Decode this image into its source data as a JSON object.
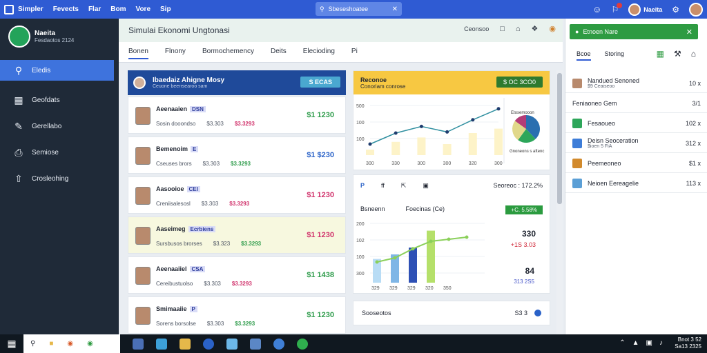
{
  "menubar": {
    "items": [
      "Simpler",
      "Fevects",
      "Flar",
      "Bom",
      "Vore",
      "Sip"
    ],
    "search_text": "Sbeseshoatee"
  },
  "sidebar": {
    "profile_name": "Naeita",
    "profile_sub": "Fesdaotos 2124",
    "items": [
      {
        "label": "Eledis",
        "icon": "search-icon",
        "active": true
      },
      {
        "label": "Geofdats",
        "icon": "grid-icon"
      },
      {
        "label": "Gerellabo",
        "icon": "pen-icon"
      },
      {
        "label": "Semiose",
        "icon": "printer-icon"
      },
      {
        "label": "Crosleohing",
        "icon": "upload-icon"
      }
    ]
  },
  "header": {
    "title": "Simulai Ekonomi Ungtonasi",
    "right_label": "Ceonsoo",
    "tabs": [
      "Bonen",
      "Flnony",
      "Bormochemency",
      "Deits",
      "Elecioding",
      "Pi"
    ]
  },
  "list": {
    "header_title": "Ibaedaiz Ahigne Mosy",
    "header_sub": "Ceuone beerrsearoo sam",
    "header_button": "S ECAS",
    "cards": [
      {
        "name": "Aeenaaien",
        "tag": "DSN",
        "m1": "Sosin dooondso",
        "m2": "$3.303",
        "m3": "$3.3293",
        "amount": "$1 1230",
        "amount_color": "#2d9b4a",
        "highlight": false
      },
      {
        "name": "Bemenoim",
        "tag": "E",
        "m1": "Cseuses brors",
        "m2": "$3.303",
        "m3": "$3.3293",
        "amount": "$1 $230",
        "amount_color": "#2a62c8",
        "highlight": false
      },
      {
        "name": "Aasooioe",
        "tag": "CEI",
        "m1": "Creniisalesosl",
        "m2": "$3.303",
        "m3": "$3.3293",
        "amount": "$1 1230",
        "amount_color": "#d0306a",
        "highlight": false
      },
      {
        "name": "Aaseimeg",
        "tag": "Ecrbiens",
        "m1": "Sursbusos brorses",
        "m2": "$3.323",
        "m3": "$3.3293",
        "amount": "$1 1230",
        "amount_color": "#d0306a",
        "highlight": true
      },
      {
        "name": "Aeenaaiiel",
        "tag": "CSA",
        "m1": "Cereibustuolso",
        "m2": "$3.303",
        "m3": "$3.3293",
        "amount": "$1 1438",
        "amount_color": "#2d9b4a",
        "highlight": false
      },
      {
        "name": "Smimaaiie",
        "tag": "P",
        "m1": "Sorens borsolse",
        "m2": "$3.303",
        "m3": "$3.3293",
        "amount": "$1 1230",
        "amount_color": "#2d9b4a",
        "highlight": false
      }
    ]
  },
  "panel1": {
    "title": "Reconoe",
    "sub": "Conoriam conrose",
    "button": "$ OC 3CO0",
    "pie_label": "Etosemooon",
    "pie_sub": "Gnoneons s aftenc",
    "chart_data": {
      "type": "line",
      "x": [
        "300",
        "330",
        "300",
        "300",
        "320",
        "300"
      ],
      "y_ticks": [
        "100",
        "100",
        "500"
      ],
      "series": [
        {
          "values": [
            1,
            2,
            2.6,
            2.1,
            3.2,
            4.2
          ]
        },
        {
          "values": [
            0.5,
            1.2,
            1.6,
            1.0,
            2.0,
            2.4
          ]
        }
      ],
      "pie": [
        0.38,
        0.22,
        0.25,
        0.15
      ],
      "colors": [
        "#2a6fb0",
        "#2da65a",
        "#e1d88a",
        "#b43c77"
      ]
    }
  },
  "panel2": {
    "icons": [
      "P",
      "ff",
      "share-icon",
      "box-icon"
    ],
    "summary": "Seoreoc : 172.2%",
    "row_a": "Bsneenn",
    "row_b": "Foecinas (Ce)",
    "green_pill": "+C. 5.58%",
    "big1": "330",
    "big1_sub": "+1S 3.03",
    "big2": "84",
    "big2_sub": "313 2S5",
    "chart_data": {
      "type": "bar",
      "x": [
        "329",
        "329",
        "329",
        "320",
        "350"
      ],
      "y_ticks": [
        "200",
        "102",
        "100",
        "300"
      ],
      "bars": [
        0.42,
        0.5,
        0.62,
        0.92,
        0
      ],
      "line": [
        0.5,
        0.6,
        0.82,
        1.0,
        1.05,
        1.1
      ],
      "colors": [
        "#b8dcf5",
        "#7fb6e6",
        "#2e50b5",
        "#b5e06a"
      ]
    }
  },
  "panel3": {
    "label": "Sooseotos",
    "count": "S3 3"
  },
  "rpanel": {
    "alert": "Etnoen Nare",
    "tabs": [
      "Bcoe",
      "Storing"
    ],
    "items": [
      {
        "label": "Nandued Senoned",
        "sub": "$9 Ceaiseoo",
        "val": "10 x",
        "color": "#b88a6d"
      },
      {
        "label": "Feniaoneo Gem",
        "sub": "",
        "val": "3/1",
        "color": ""
      },
      {
        "label": "Fesaoueo",
        "sub": "",
        "val": "102 x",
        "color": "#2da65a"
      },
      {
        "label": "Deisn Seoceration",
        "sub": "$ioen 5 FiA",
        "val": "312 x",
        "color": "#3d7dd8"
      },
      {
        "label": "Peemeoneo",
        "sub": "",
        "val": "$1 x",
        "color": "#d28a2c"
      },
      {
        "label": "Neioen Eereagelie",
        "sub": "",
        "val": "113 x",
        "color": "#5b9fd6"
      }
    ]
  },
  "taskbar": {
    "time": "Bnot 3 52",
    "date": "Sa13 2325"
  }
}
